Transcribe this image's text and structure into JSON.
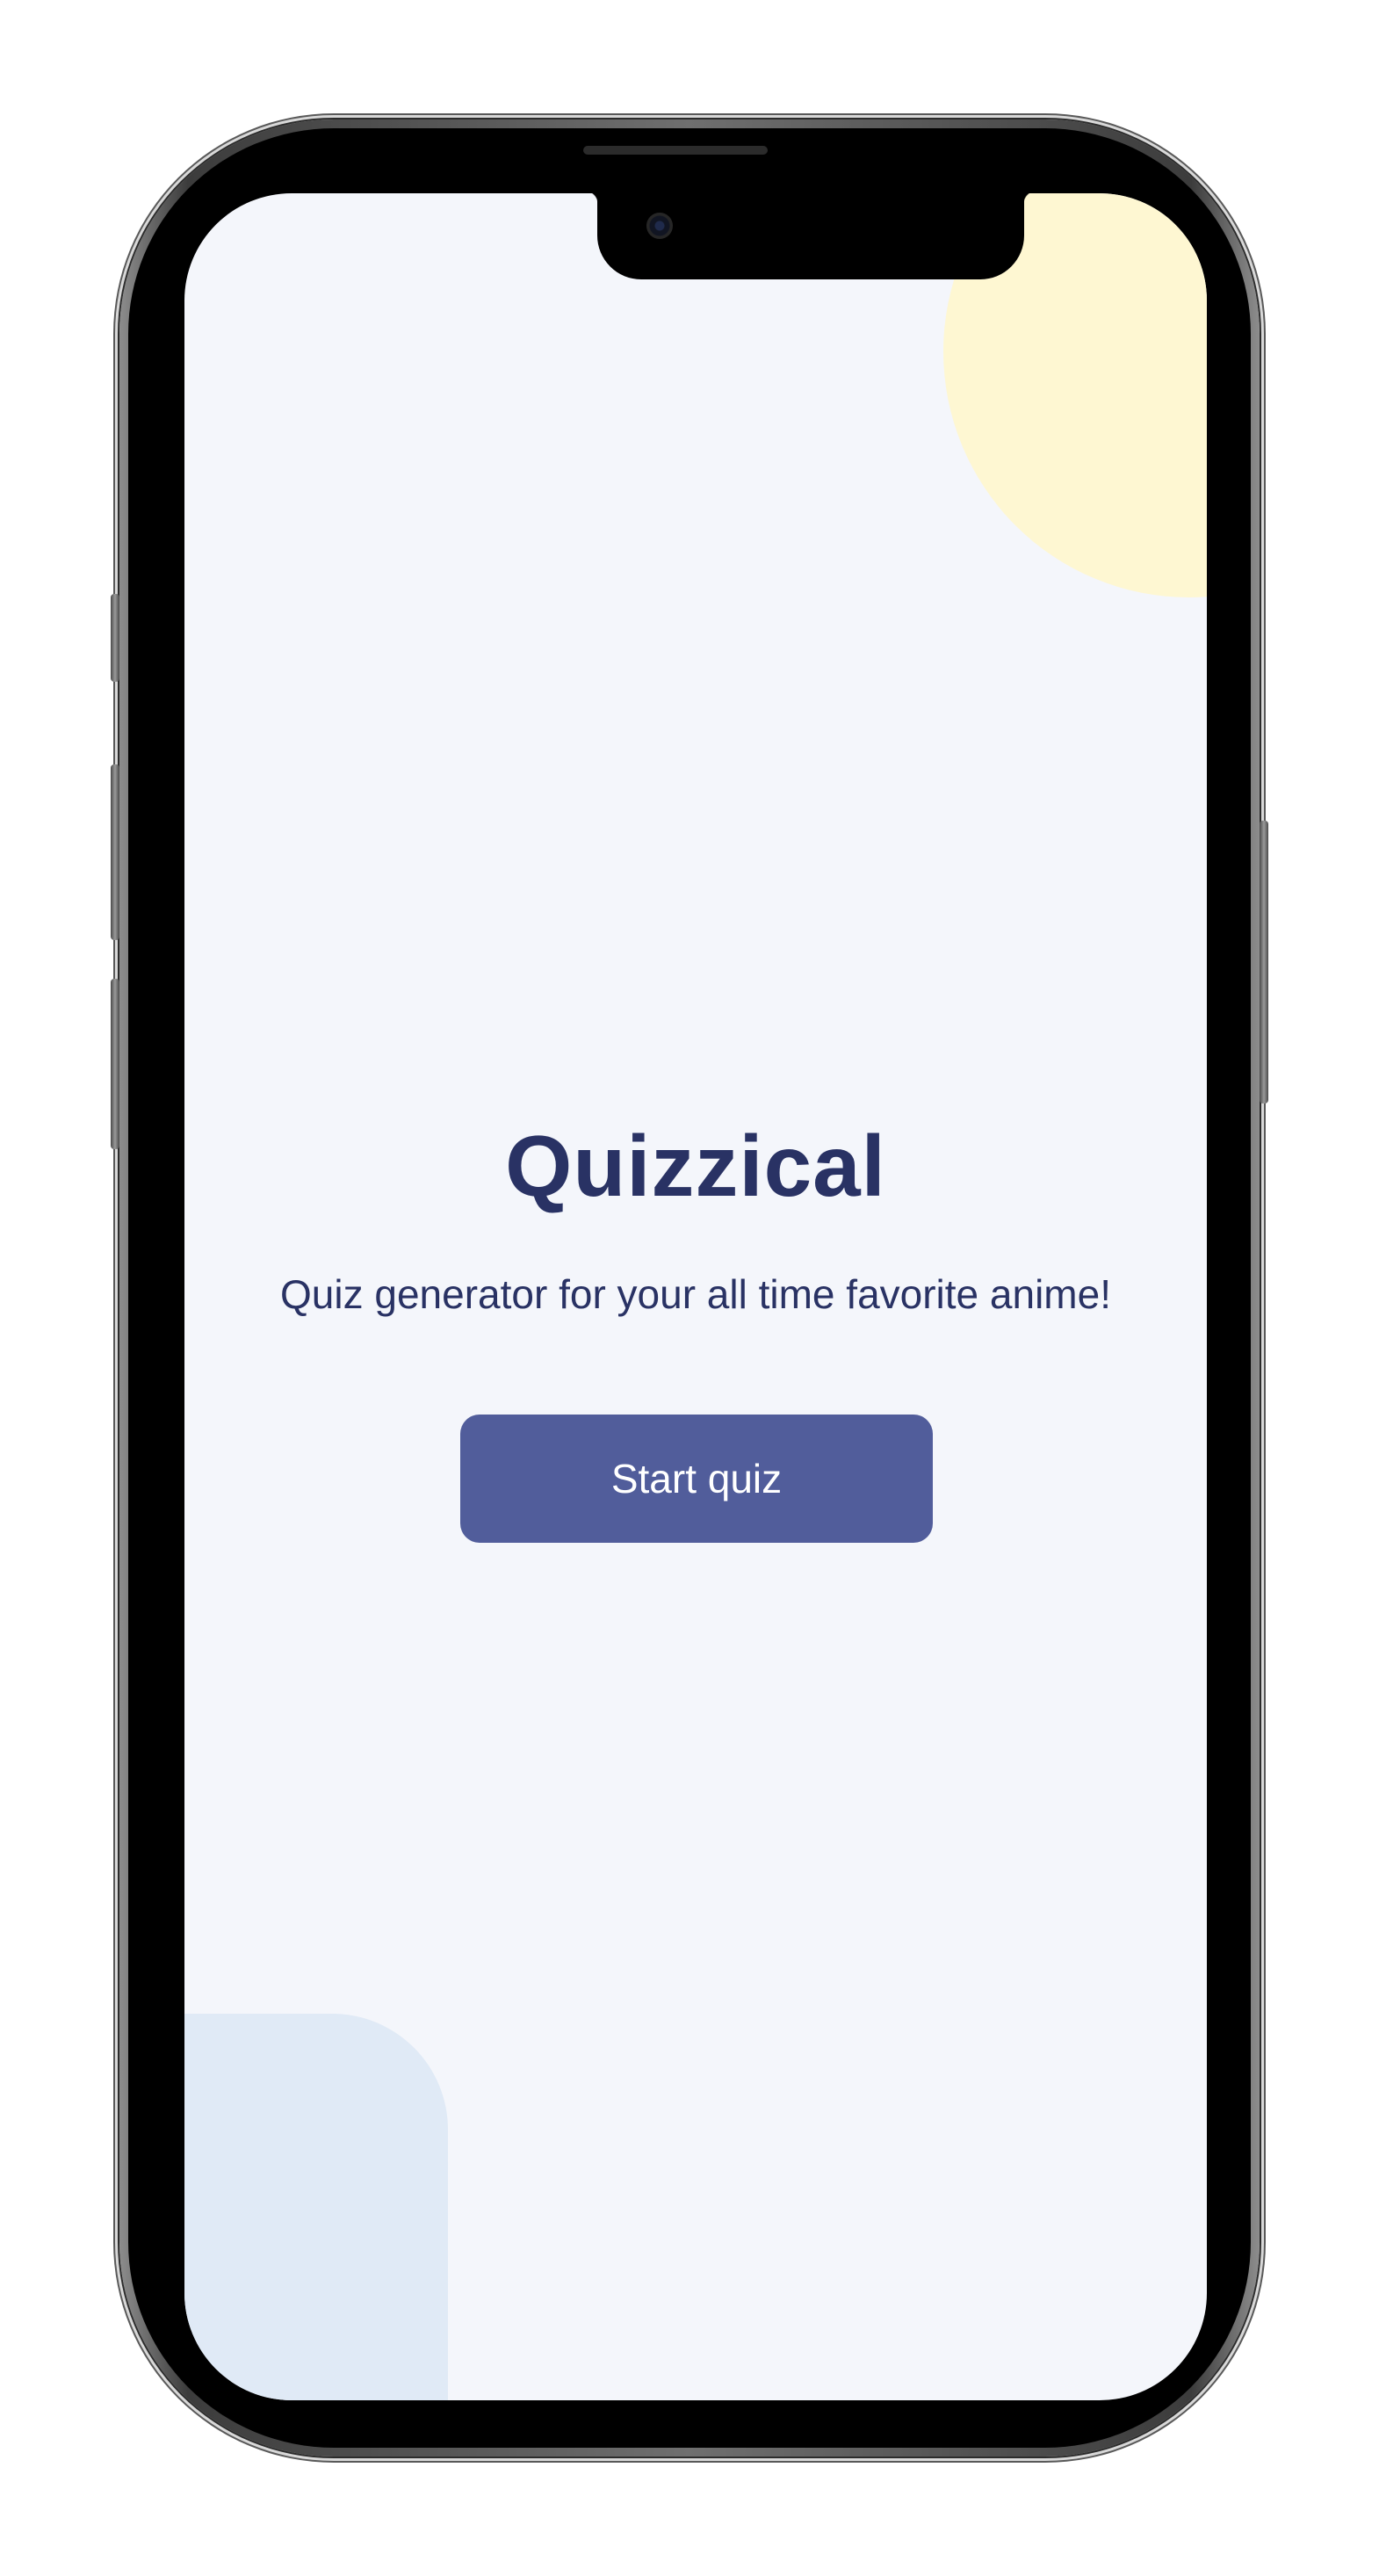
{
  "app": {
    "title": "Quizzical",
    "subtitle": "Quiz generator for your all time favorite anime!",
    "start_button_label": "Start quiz"
  },
  "colors": {
    "background": "#f4f6fb",
    "title_text": "#293264",
    "button": "#515d9b",
    "button_text": "#ffffff",
    "blob_yellow": "#fef7d2",
    "blob_blue": "#e0eaf6"
  }
}
